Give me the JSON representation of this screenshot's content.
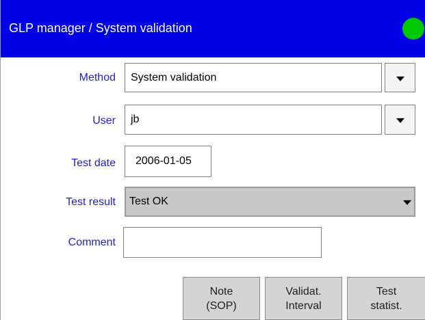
{
  "window": {
    "title": "GLP manager / System validation",
    "status_color": "#00c800",
    "status_icon": "green-status-indicator-icon"
  },
  "form": {
    "method": {
      "label": "Method",
      "value": "System validation"
    },
    "user": {
      "label": "User",
      "value": "jb"
    },
    "test_date": {
      "label": "Test date",
      "value": "2006-01-05"
    },
    "test_result": {
      "label": "Test result",
      "value": "Test OK"
    },
    "comment": {
      "label": "Comment",
      "value": ""
    }
  },
  "buttons": {
    "note": {
      "line1": "Note",
      "line2": "(SOP)"
    },
    "validat": {
      "line1": "Validat.",
      "line2": "Interval"
    },
    "test": {
      "line1": "Test",
      "line2": "statist."
    }
  },
  "colors": {
    "title_bar": "#0000e6",
    "label_text": "#2020d0"
  }
}
